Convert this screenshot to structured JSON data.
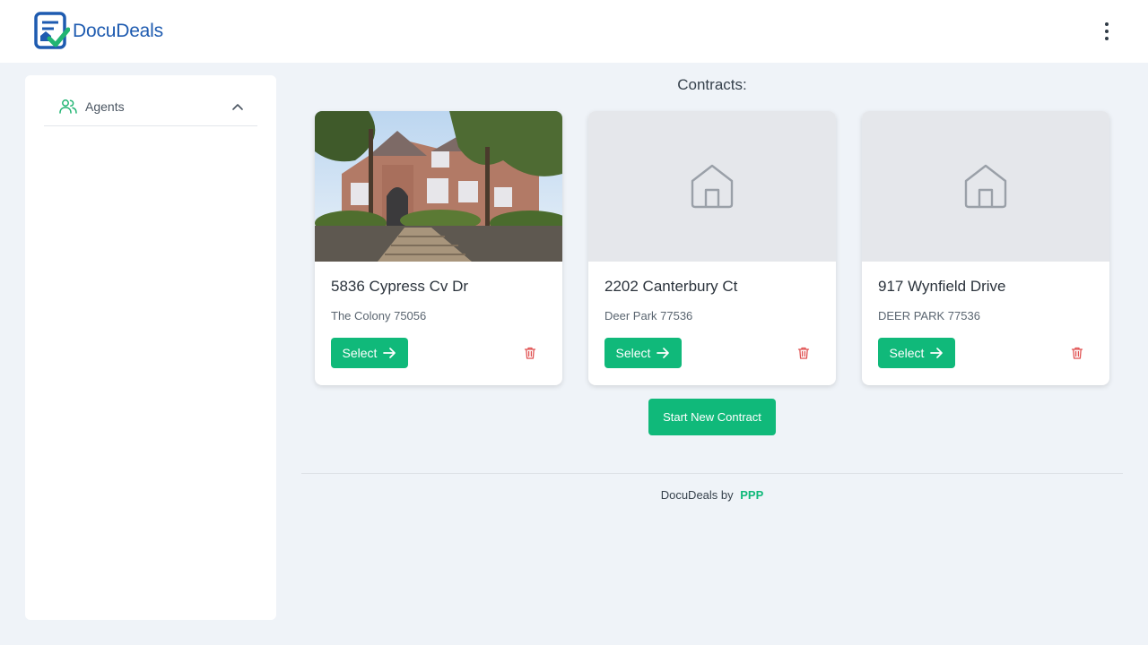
{
  "header": {
    "logo_text": "DocuDeals",
    "menu_icon": "kebab-menu-icon"
  },
  "sidebar": {
    "items": [
      {
        "label": "Agents",
        "icon": "users-icon",
        "expanded": true
      }
    ]
  },
  "main": {
    "title": "Contracts:",
    "contracts": [
      {
        "title": "5836 Cypress Cv Dr",
        "subtitle": "The Colony 75056",
        "has_photo": true,
        "select_label": "Select"
      },
      {
        "title": "2202 Canterbury Ct",
        "subtitle": "Deer Park 77536",
        "has_photo": false,
        "select_label": "Select"
      },
      {
        "title": "917 Wynfield Drive",
        "subtitle": "DEER PARK 77536",
        "has_photo": false,
        "select_label": "Select"
      }
    ],
    "new_contract_label": "Start New Contract"
  },
  "footer": {
    "text": "DocuDeals by",
    "brand": "PPP"
  },
  "colors": {
    "accent": "#10b97a",
    "logo_blue": "#1e5bb0",
    "danger": "#e05252",
    "background": "#eff3f8"
  }
}
